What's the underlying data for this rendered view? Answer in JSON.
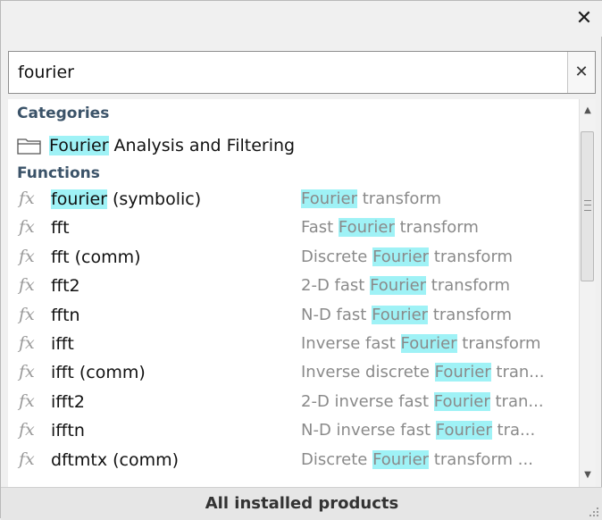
{
  "window": {
    "close_glyph": "✕"
  },
  "search": {
    "value": "fourier",
    "clear_glyph": "✕"
  },
  "results": {
    "categories_header": "Categories",
    "categories": [
      {
        "label_hl": "Fourier",
        "label_rest": " Analysis and Filtering",
        "icon": "folder-icon"
      }
    ],
    "functions_header": "Functions",
    "functions": [
      {
        "name_hl": "fourier",
        "name_rest": " (symbolic)",
        "desc_pre": "",
        "desc_hl": "Fourier",
        "desc_post": " transform"
      },
      {
        "name_hl": "",
        "name_rest": "fft",
        "desc_pre": "Fast ",
        "desc_hl": "Fourier",
        "desc_post": " transform"
      },
      {
        "name_hl": "",
        "name_rest": "fft (comm)",
        "desc_pre": "Discrete ",
        "desc_hl": "Fourier",
        "desc_post": " transform"
      },
      {
        "name_hl": "",
        "name_rest": "fft2",
        "desc_pre": "2-D fast ",
        "desc_hl": "Fourier",
        "desc_post": " transform"
      },
      {
        "name_hl": "",
        "name_rest": "fftn",
        "desc_pre": "N-D fast ",
        "desc_hl": "Fourier",
        "desc_post": " transform"
      },
      {
        "name_hl": "",
        "name_rest": "ifft",
        "desc_pre": "Inverse fast ",
        "desc_hl": "Fourier",
        "desc_post": " transform"
      },
      {
        "name_hl": "",
        "name_rest": "ifft (comm)",
        "desc_pre": "Inverse discrete ",
        "desc_hl": "Fourier",
        "desc_post": " tran..."
      },
      {
        "name_hl": "",
        "name_rest": "ifft2",
        "desc_pre": "2-D inverse fast ",
        "desc_hl": "Fourier",
        "desc_post": " tran..."
      },
      {
        "name_hl": "",
        "name_rest": "ifftn",
        "desc_pre": "N-D inverse fast ",
        "desc_hl": "Fourier",
        "desc_post": " tra..."
      },
      {
        "name_hl": "",
        "name_rest": "dftmtx (comm)",
        "desc_pre": "Discrete ",
        "desc_hl": "Fourier",
        "desc_post": " transform ..."
      }
    ],
    "fx_glyph": "fx"
  },
  "footer": {
    "label": "All installed products"
  },
  "colors": {
    "highlight": "#9ff2f6",
    "section_header": "#3b5369",
    "desc_text": "#8a8a8a"
  }
}
